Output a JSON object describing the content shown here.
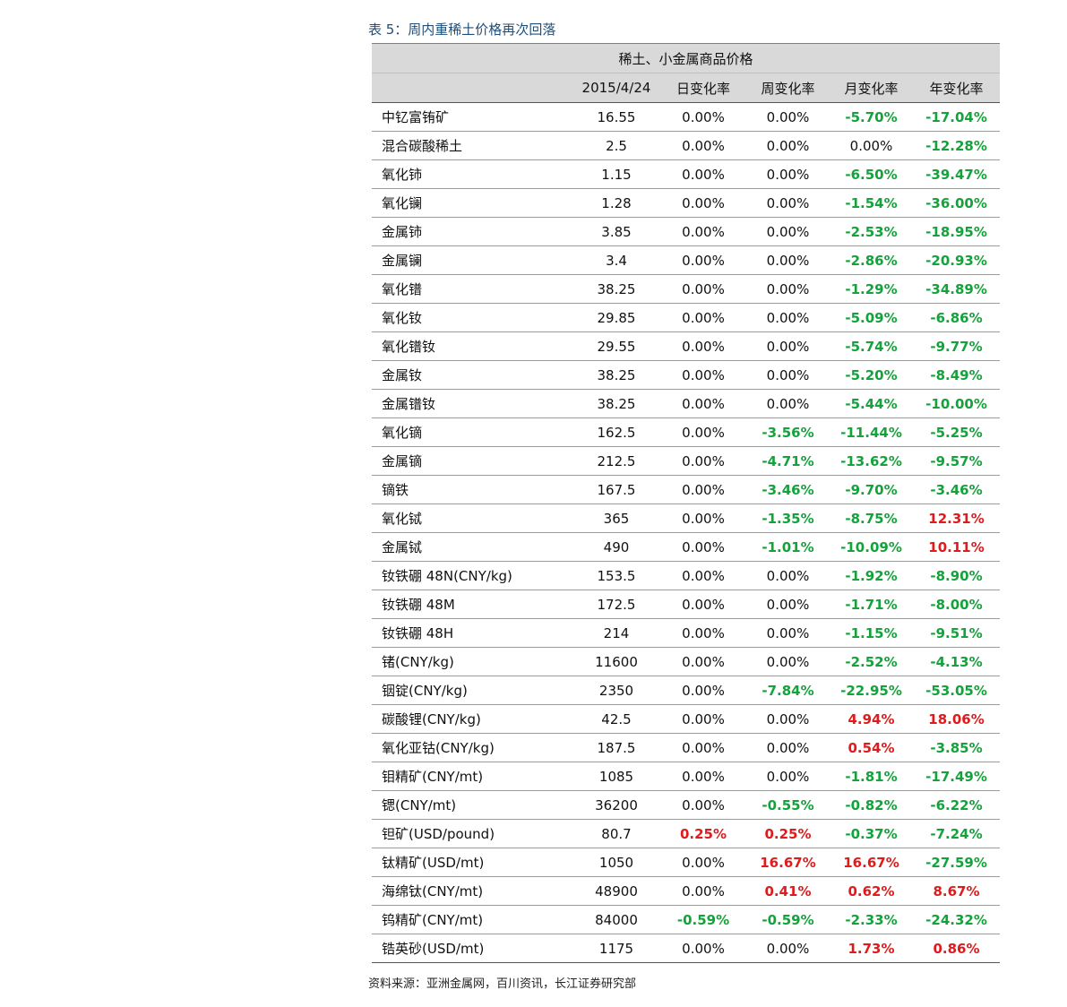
{
  "caption": "表 5：周内重稀土价格再次回落",
  "table": {
    "group_header": "稀土、小金属商品价格",
    "columns": [
      "",
      "2015/4/24",
      "日变化率",
      "周变化率",
      "月变化率",
      "年变化率"
    ],
    "rows": [
      [
        "中钇富铕矿",
        "16.55",
        "0.00%",
        "0.00%",
        "-5.70%",
        "-17.04%"
      ],
      [
        "混合碳酸稀土",
        "2.5",
        "0.00%",
        "0.00%",
        "0.00%",
        "-12.28%"
      ],
      [
        "氧化铈",
        "1.15",
        "0.00%",
        "0.00%",
        "-6.50%",
        "-39.47%"
      ],
      [
        "氧化镧",
        "1.28",
        "0.00%",
        "0.00%",
        "-1.54%",
        "-36.00%"
      ],
      [
        "金属铈",
        "3.85",
        "0.00%",
        "0.00%",
        "-2.53%",
        "-18.95%"
      ],
      [
        "金属镧",
        "3.4",
        "0.00%",
        "0.00%",
        "-2.86%",
        "-20.93%"
      ],
      [
        "氧化镨",
        "38.25",
        "0.00%",
        "0.00%",
        "-1.29%",
        "-34.89%"
      ],
      [
        "氧化钕",
        "29.85",
        "0.00%",
        "0.00%",
        "-5.09%",
        "-6.86%"
      ],
      [
        "氧化镨钕",
        "29.55",
        "0.00%",
        "0.00%",
        "-5.74%",
        "-9.77%"
      ],
      [
        "金属钕",
        "38.25",
        "0.00%",
        "0.00%",
        "-5.20%",
        "-8.49%"
      ],
      [
        "金属镨钕",
        "38.25",
        "0.00%",
        "0.00%",
        "-5.44%",
        "-10.00%"
      ],
      [
        "氧化镝",
        "162.5",
        "0.00%",
        "-3.56%",
        "-11.44%",
        "-5.25%"
      ],
      [
        "金属镝",
        "212.5",
        "0.00%",
        "-4.71%",
        "-13.62%",
        "-9.57%"
      ],
      [
        "镝铁",
        "167.5",
        "0.00%",
        "-3.46%",
        "-9.70%",
        "-3.46%"
      ],
      [
        "氧化铽",
        "365",
        "0.00%",
        "-1.35%",
        "-8.75%",
        "12.31%"
      ],
      [
        "金属铽",
        "490",
        "0.00%",
        "-1.01%",
        "-10.09%",
        "10.11%"
      ],
      [
        "钕铁硼 48N(CNY/kg)",
        "153.5",
        "0.00%",
        "0.00%",
        "-1.92%",
        "-8.90%"
      ],
      [
        "钕铁硼 48M",
        "172.5",
        "0.00%",
        "0.00%",
        "-1.71%",
        "-8.00%"
      ],
      [
        "钕铁硼 48H",
        "214",
        "0.00%",
        "0.00%",
        "-1.15%",
        "-9.51%"
      ],
      [
        "锗(CNY/kg)",
        "11600",
        "0.00%",
        "0.00%",
        "-2.52%",
        "-4.13%"
      ],
      [
        "铟锭(CNY/kg)",
        "2350",
        "0.00%",
        "-7.84%",
        "-22.95%",
        "-53.05%"
      ],
      [
        "碳酸锂(CNY/kg)",
        "42.5",
        "0.00%",
        "0.00%",
        "4.94%",
        "18.06%"
      ],
      [
        "氧化亚钴(CNY/kg)",
        "187.5",
        "0.00%",
        "0.00%",
        "0.54%",
        "-3.85%"
      ],
      [
        "钼精矿(CNY/mt)",
        "1085",
        "0.00%",
        "0.00%",
        "-1.81%",
        "-17.49%"
      ],
      [
        "锶(CNY/mt)",
        "36200",
        "0.00%",
        "-0.55%",
        "-0.82%",
        "-6.22%"
      ],
      [
        "钽矿(USD/pound)",
        "80.7",
        "0.25%",
        "0.25%",
        "-0.37%",
        "-7.24%"
      ],
      [
        "钛精矿(USD/mt)",
        "1050",
        "0.00%",
        "16.67%",
        "16.67%",
        "-27.59%"
      ],
      [
        "海绵钛(CNY/mt)",
        "48900",
        "0.00%",
        "0.41%",
        "0.62%",
        "8.67%"
      ],
      [
        "钨精矿(CNY/mt)",
        "84000",
        "-0.59%",
        "-0.59%",
        "-2.33%",
        "-24.32%"
      ],
      [
        "锆英砂(USD/mt)",
        "1175",
        "0.00%",
        "0.00%",
        "1.73%",
        "0.86%"
      ]
    ]
  },
  "colors": {
    "negative": "#14a33b",
    "positive": "#e01b1b",
    "header_bg": "#d9d9d9",
    "caption": "#1f4e79"
  },
  "source": "资料来源：亚洲金属网，百川资讯，长江证券研究部"
}
